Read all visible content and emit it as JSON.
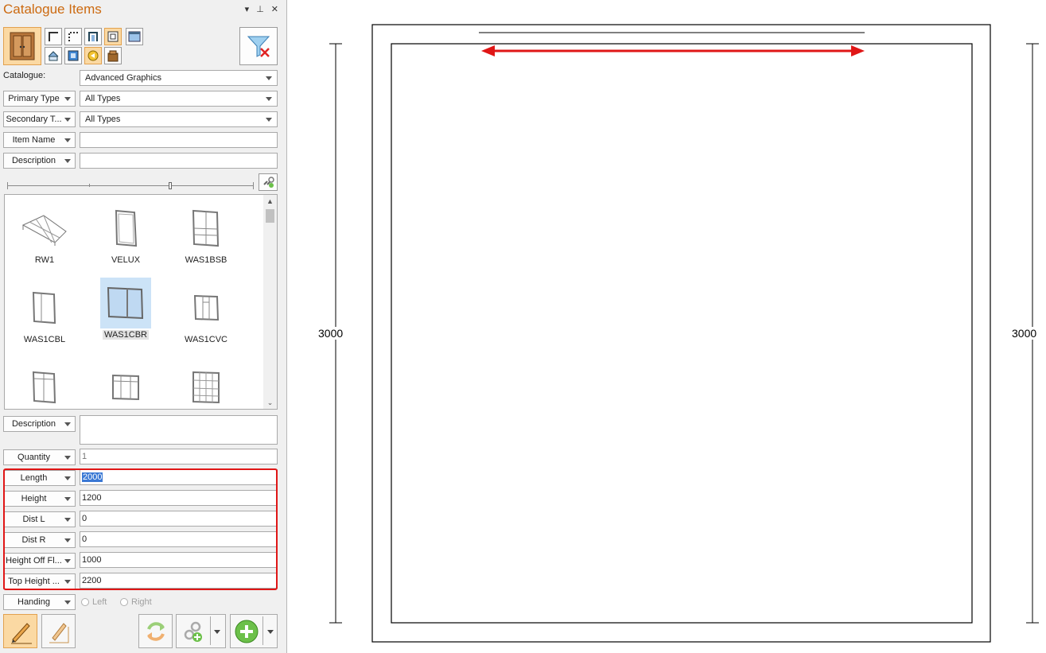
{
  "panel": {
    "title": "Catalogue Items",
    "controls": {
      "menu": "▾",
      "pin": "⊥",
      "close": "✕"
    }
  },
  "catalogue": {
    "label": "Catalogue:",
    "value": "Advanced Graphics"
  },
  "filters": {
    "primary_type": {
      "label": "Primary Type",
      "value": "All Types"
    },
    "secondary_type": {
      "label": "Secondary T...",
      "value": "All Types"
    },
    "item_name": {
      "label": "Item Name",
      "value": ""
    },
    "description": {
      "label": "Description",
      "value": ""
    }
  },
  "gallery": {
    "items": [
      {
        "name": "RW1",
        "icon": "roof-window-icon"
      },
      {
        "name": "VELUX",
        "icon": "velux-window-icon"
      },
      {
        "name": "WAS1BSB",
        "icon": "sash-window-icon"
      },
      {
        "name": "WAS1CBL",
        "icon": "casement-left-icon"
      },
      {
        "name": "WAS1CBR",
        "icon": "casement-right-icon",
        "selected": true
      },
      {
        "name": "WAS1CVC",
        "icon": "casement-vent-icon"
      },
      {
        "name": "",
        "icon": "window-icon"
      },
      {
        "name": "",
        "icon": "window-icon"
      },
      {
        "name": "",
        "icon": "georgian-window-icon"
      }
    ]
  },
  "properties": {
    "description": {
      "label": "Description",
      "value": ""
    },
    "quantity": {
      "label": "Quantity",
      "value": "1"
    },
    "length": {
      "label": "Length",
      "value": "2000"
    },
    "height": {
      "label": "Height",
      "value": "1200"
    },
    "dist_l": {
      "label": "Dist L",
      "value": "0"
    },
    "dist_r": {
      "label": "Dist R",
      "value": "0"
    },
    "height_off_floor": {
      "label": "Height Off Fl...",
      "value": "1000"
    },
    "top_height": {
      "label": "Top Height ...",
      "value": "2200"
    },
    "handing": {
      "label": "Handing",
      "options": [
        "Left",
        "Right"
      ]
    }
  },
  "drawing": {
    "left_dimension": "3000",
    "right_dimension": "3000",
    "accent": "#e01616"
  }
}
